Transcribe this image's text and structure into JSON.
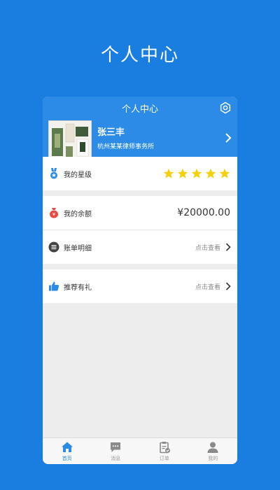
{
  "hero": {
    "title": "个人中心"
  },
  "nav": {
    "title": "个人中心"
  },
  "profile": {
    "name": "张三丰",
    "company": "杭州某某律师事务所"
  },
  "rating": {
    "label": "我的星级",
    "stars": 5,
    "max_stars": 5,
    "star_color": "#f5d10c"
  },
  "balance": {
    "label": "我的余额",
    "value": "¥20000.00"
  },
  "bill": {
    "label": "账单明细",
    "hint": "点击查看"
  },
  "referral": {
    "label": "推荐有礼",
    "hint": "点击查看"
  },
  "tabs": [
    {
      "label": "首页",
      "icon": "home-icon",
      "active": true
    },
    {
      "label": "消息",
      "icon": "message-icon",
      "active": false
    },
    {
      "label": "订单",
      "icon": "order-icon",
      "active": false
    },
    {
      "label": "我的",
      "icon": "user-icon",
      "active": false
    }
  ],
  "colors": {
    "background": "#1a7ee0",
    "accent": "#2b8be6"
  }
}
